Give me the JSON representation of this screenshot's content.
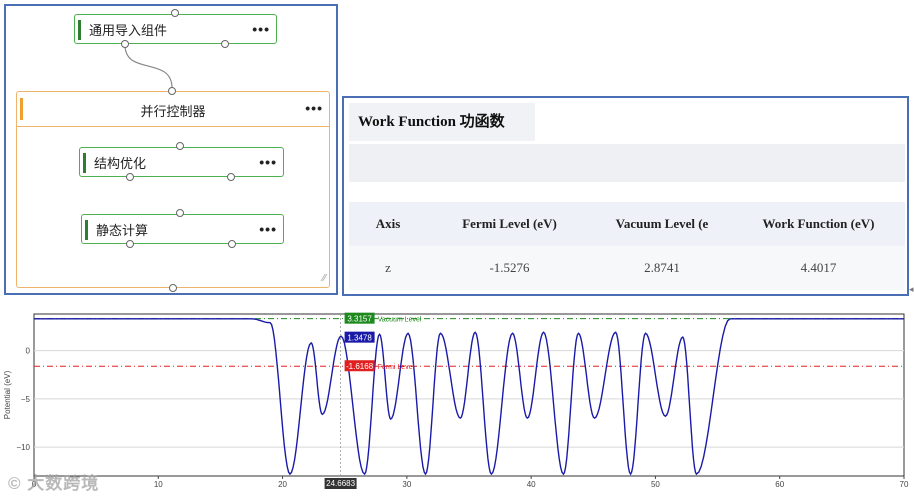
{
  "workflow": {
    "import_node": {
      "label": "通用导入组件",
      "more": "•••"
    },
    "group": {
      "title": "并行控制器",
      "more": "•••",
      "resize": "⁄⁄"
    },
    "optimize_node": {
      "label": "结构优化",
      "more": "•••"
    },
    "static_node": {
      "label": "静态计算",
      "more": "•••"
    }
  },
  "work_function": {
    "title": "Work Function 功函数",
    "columns": [
      "Axis",
      "Fermi Level (eV)",
      "Vacuum Level (e",
      "Work Function (eV)"
    ],
    "rows": [
      [
        "z",
        "-1.5276",
        "2.8741",
        "4.4017"
      ]
    ]
  },
  "chart_data": {
    "type": "line",
    "xlim": [
      0,
      70
    ],
    "ylim": [
      -13,
      3.8
    ],
    "xticks": [
      "0",
      "10",
      "20",
      "30",
      "40",
      "50",
      "60",
      "70"
    ],
    "yticks": [
      "0",
      "−5",
      "−10"
    ],
    "ylabel": "Potential (eV)",
    "series": [
      {
        "name": "",
        "color": "#1a1aa8",
        "x": [
          0,
          17.5,
          19,
          20.6,
          22.3,
          23.2,
          24.7,
          26.6,
          27.8,
          28.7,
          30.1,
          31.5,
          32.7,
          34.3,
          35.5,
          36.8,
          38.5,
          39.7,
          41,
          42.6,
          43.8,
          45.1,
          46.8,
          48,
          49.2,
          50.8,
          52.2,
          53.3,
          56,
          70
        ],
        "y": [
          3.3,
          3.3,
          2.9,
          -12.8,
          0.8,
          -6.6,
          1.5,
          -12.8,
          1.7,
          -7.1,
          1.8,
          -12.8,
          1.8,
          -7.0,
          1.9,
          -12.8,
          1.8,
          -7.0,
          1.9,
          -12.8,
          1.8,
          -7.0,
          1.9,
          -12.8,
          1.8,
          -6.8,
          1.4,
          -12.8,
          3.3,
          3.3
        ]
      }
    ],
    "hlines": [
      {
        "name": "Vacuum Level",
        "value": 3.3157,
        "label": "3.3157",
        "color": "#1e8a1e"
      },
      {
        "name": "Fermi Level",
        "value": -1.6168,
        "label": "-1.6168",
        "color": "#e02020"
      }
    ],
    "marker": {
      "label": "1.3478",
      "value": 1.3478,
      "x": 24.6683
    },
    "crosshair_x_label": "24.6683"
  },
  "watermark": "© 大数跨境"
}
